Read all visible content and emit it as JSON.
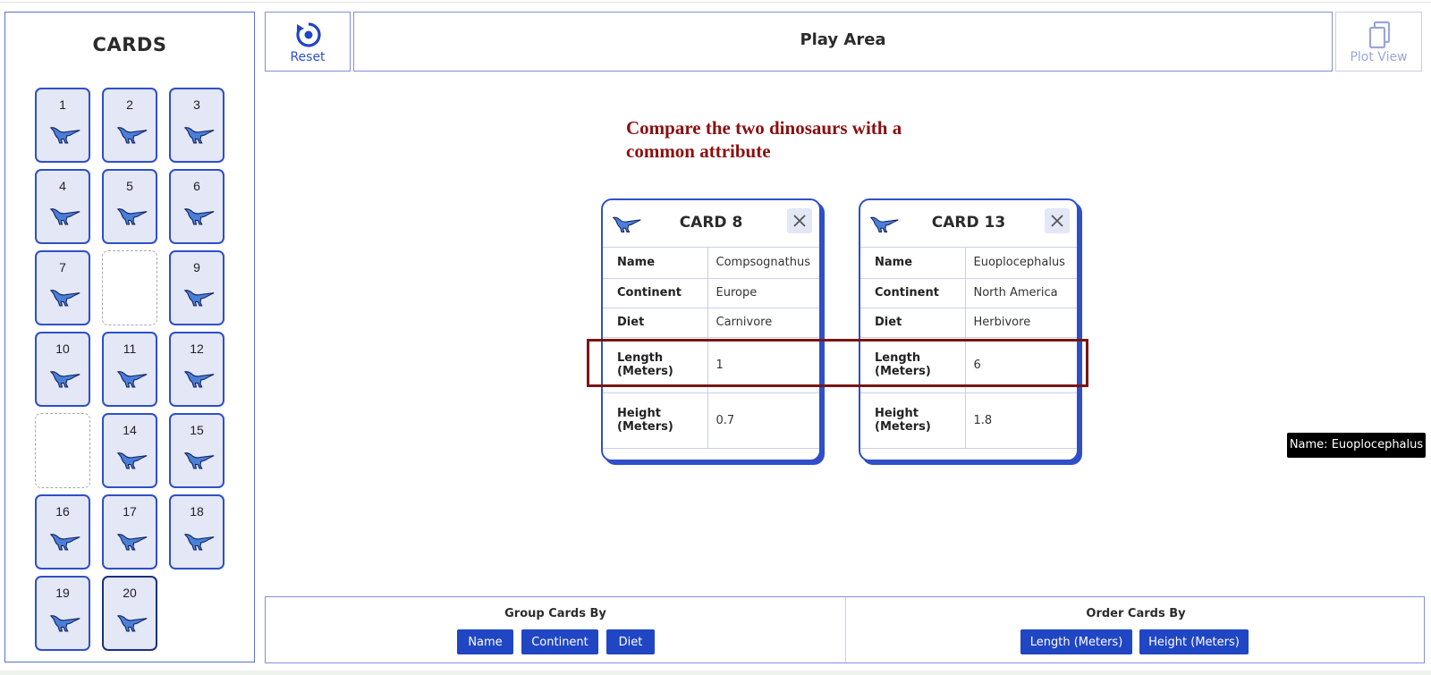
{
  "sidebar": {
    "title": "CARDS",
    "cards": [
      {
        "label": "1",
        "state": "filled"
      },
      {
        "label": "2",
        "state": "filled"
      },
      {
        "label": "3",
        "state": "filled"
      },
      {
        "label": "4",
        "state": "filled"
      },
      {
        "label": "5",
        "state": "filled"
      },
      {
        "label": "6",
        "state": "filled"
      },
      {
        "label": "7",
        "state": "filled"
      },
      {
        "label": "",
        "state": "empty"
      },
      {
        "label": "9",
        "state": "filled"
      },
      {
        "label": "10",
        "state": "filled"
      },
      {
        "label": "11",
        "state": "filled"
      },
      {
        "label": "12",
        "state": "filled"
      },
      {
        "label": "",
        "state": "empty"
      },
      {
        "label": "14",
        "state": "filled"
      },
      {
        "label": "15",
        "state": "filled"
      },
      {
        "label": "16",
        "state": "filled"
      },
      {
        "label": "17",
        "state": "filled"
      },
      {
        "label": "18",
        "state": "filled"
      },
      {
        "label": "19",
        "state": "filled"
      },
      {
        "label": "20",
        "state": "selected"
      }
    ]
  },
  "toolbar": {
    "reset_label": "Reset",
    "title": "Play Area",
    "plot_view_label": "Plot View"
  },
  "instruction": "Compare the two dinosaurs with a common attribute",
  "cards": [
    {
      "title": "CARD 8",
      "rows": [
        {
          "key": "Name",
          "value": "Compsognathus"
        },
        {
          "key": "Continent",
          "value": "Europe"
        },
        {
          "key": "Diet",
          "value": "Carnivore"
        },
        {
          "key": "Length (Meters)",
          "value": "1"
        },
        {
          "key": "Height (Meters)",
          "value": "0.7"
        }
      ]
    },
    {
      "title": "CARD 13",
      "rows": [
        {
          "key": "Name",
          "value": "Euoplocephalus"
        },
        {
          "key": "Continent",
          "value": "North America"
        },
        {
          "key": "Diet",
          "value": "Herbivore"
        },
        {
          "key": "Length (Meters)",
          "value": "6"
        },
        {
          "key": "Height (Meters)",
          "value": "1.8"
        }
      ]
    }
  ],
  "tooltip": "Name: Euoplocephalus",
  "group_by": {
    "title": "Group Cards By",
    "buttons": [
      "Name",
      "Continent",
      "Diet"
    ]
  },
  "order_by": {
    "title": "Order Cards By",
    "buttons": [
      "Length (Meters)",
      "Height (Meters)"
    ]
  },
  "colors": {
    "accent": "#2046c4",
    "card_fill": "#e3e7f6",
    "highlight": "#7a1515",
    "instruction": "#8b1010"
  },
  "icons": {
    "reset": "reset-icon",
    "plot_view": "plot-view-icon",
    "dinosaur": "dinosaur-icon",
    "close": "close-icon"
  }
}
